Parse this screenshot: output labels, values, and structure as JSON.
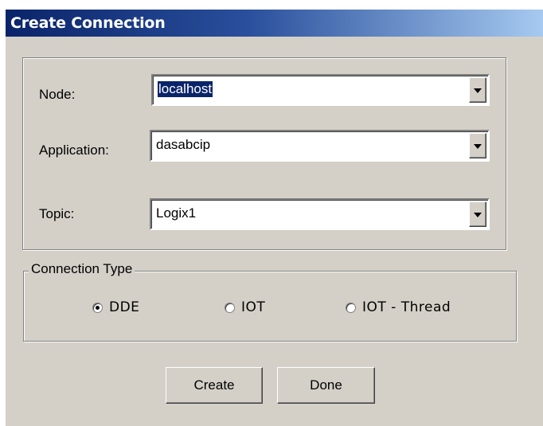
{
  "window": {
    "title": "Create Connection"
  },
  "fields": {
    "node": {
      "label": "Node:",
      "value": "localhost"
    },
    "application": {
      "label": "Application:",
      "value": "dasabcip"
    },
    "topic": {
      "label": "Topic:",
      "value": "Logix1"
    }
  },
  "connection_type": {
    "legend": "Connection Type",
    "options": [
      {
        "label": "DDE",
        "selected": true
      },
      {
        "label": "IOT",
        "selected": false
      },
      {
        "label": "IOT - Thread",
        "selected": false
      }
    ]
  },
  "buttons": {
    "create": "Create",
    "done": "Done"
  },
  "icons": {
    "dropdown": "chevron-down-icon",
    "radio": "radio-icon"
  },
  "colors": {
    "titlebar_start": "#0a246a",
    "titlebar_end": "#a6caf0",
    "dialog_bg": "#d4d0c8",
    "selection": "#0a246a"
  }
}
